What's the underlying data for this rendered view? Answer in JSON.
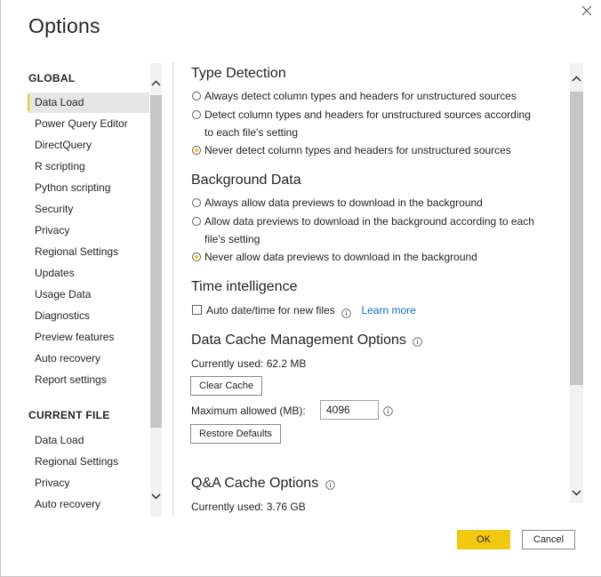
{
  "dialog": {
    "title": "Options",
    "close_icon": "close-icon"
  },
  "nav": {
    "global_heading": "GLOBAL",
    "global_items": [
      {
        "label": "Data Load",
        "active": true
      },
      {
        "label": "Power Query Editor"
      },
      {
        "label": "DirectQuery"
      },
      {
        "label": "R scripting"
      },
      {
        "label": "Python scripting"
      },
      {
        "label": "Security"
      },
      {
        "label": "Privacy"
      },
      {
        "label": "Regional Settings"
      },
      {
        "label": "Updates"
      },
      {
        "label": "Usage Data"
      },
      {
        "label": "Diagnostics"
      },
      {
        "label": "Preview features"
      },
      {
        "label": "Auto recovery"
      },
      {
        "label": "Report settings"
      }
    ],
    "current_file_heading": "CURRENT FILE",
    "current_file_items": [
      {
        "label": "Data Load"
      },
      {
        "label": "Regional Settings"
      },
      {
        "label": "Privacy"
      },
      {
        "label": "Auto recovery"
      }
    ]
  },
  "content": {
    "type_detection": {
      "title": "Type Detection",
      "options": [
        {
          "label": "Always detect column types and headers for unstructured sources",
          "selected": false
        },
        {
          "label": "Detect column types and headers for unstructured sources according to each file's setting",
          "selected": false
        },
        {
          "label": "Never detect column types and headers for unstructured sources",
          "selected": true
        }
      ]
    },
    "background_data": {
      "title": "Background Data",
      "options": [
        {
          "label": "Always allow data previews to download in the background",
          "selected": false
        },
        {
          "label": "Allow data previews to download in the background according to each file's setting",
          "selected": false
        },
        {
          "label": "Never allow data previews to download in the background",
          "selected": true
        }
      ]
    },
    "time_intelligence": {
      "title": "Time intelligence",
      "checkbox_label": "Auto date/time for new files",
      "checked": false,
      "learn_more": "Learn more"
    },
    "data_cache": {
      "title": "Data Cache Management Options",
      "currently_used": "Currently used: 62.2 MB",
      "clear_button": "Clear Cache",
      "max_label": "Maximum allowed (MB):",
      "max_value": "4096",
      "restore_button": "Restore Defaults"
    },
    "qa_cache": {
      "title": "Q&A Cache Options",
      "currently_used": "Currently used: 3.76 GB"
    }
  },
  "footer": {
    "ok": "OK",
    "cancel": "Cancel"
  },
  "colors": {
    "accent": "#f2c811",
    "link": "#106ebe"
  }
}
